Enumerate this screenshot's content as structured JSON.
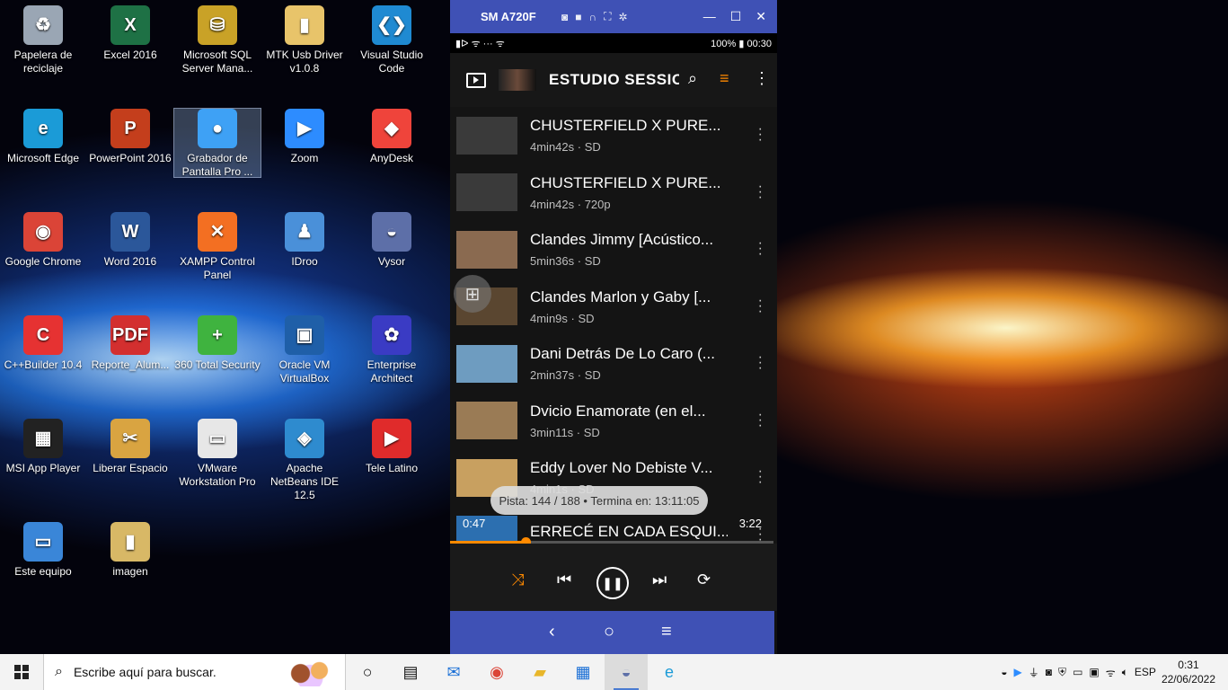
{
  "desktop": {
    "icons": [
      {
        "label": "Papelera de reciclaje",
        "glyph": "♻",
        "color": "#9aa6b4"
      },
      {
        "label": "Excel 2016",
        "glyph": "X",
        "color": "#1e7145"
      },
      {
        "label": "Microsoft SQL Server Mana...",
        "glyph": "⛁",
        "color": "#c9a227"
      },
      {
        "label": "MTK Usb Driver v1.0.8",
        "glyph": "▮",
        "color": "#e8c46a"
      },
      {
        "label": "Visual Studio Code",
        "glyph": "❮❯",
        "color": "#1f8ad2"
      },
      {
        "label": "Microsoft Edge",
        "glyph": "e",
        "color": "#1b9bd7"
      },
      {
        "label": "PowerPoint 2016",
        "glyph": "P",
        "color": "#c43e1c"
      },
      {
        "label": "Grabador de Pantalla Pro ...",
        "glyph": "●",
        "color": "#3ea1f5"
      },
      {
        "label": "Zoom",
        "glyph": "▶",
        "color": "#2d8cff"
      },
      {
        "label": "AnyDesk",
        "glyph": "◆",
        "color": "#ef443b"
      },
      {
        "label": "Google Chrome",
        "glyph": "◉",
        "color": "#db4437"
      },
      {
        "label": "Word 2016",
        "glyph": "W",
        "color": "#2b579a"
      },
      {
        "label": "XAMPP Control Panel",
        "glyph": "✕",
        "color": "#f36f22"
      },
      {
        "label": "IDroo",
        "glyph": "♟",
        "color": "#4a90d9"
      },
      {
        "label": "Vysor",
        "glyph": "◒",
        "color": "#5d6fa8"
      },
      {
        "label": "C++Builder 10.4",
        "glyph": "C",
        "color": "#e63232"
      },
      {
        "label": "Reporte_Alum...",
        "glyph": "PDF",
        "color": "#d32f2f"
      },
      {
        "label": "360 Total Security",
        "glyph": "+",
        "color": "#3fb33f"
      },
      {
        "label": "Oracle VM VirtualBox",
        "glyph": "▣",
        "color": "#1f5fa8"
      },
      {
        "label": "Enterprise Architect",
        "glyph": "✿",
        "color": "#3a3bc4"
      },
      {
        "label": "MSI App Player",
        "glyph": "▦",
        "color": "#222222"
      },
      {
        "label": "Liberar Espacio",
        "glyph": "✂",
        "color": "#d9a441"
      },
      {
        "label": "VMware Workstation Pro",
        "glyph": "▭",
        "color": "#e7e7e7"
      },
      {
        "label": "Apache NetBeans IDE 12.5",
        "glyph": "◈",
        "color": "#2e8bcf"
      },
      {
        "label": "Tele Latino",
        "glyph": "▶",
        "color": "#e02b2b"
      },
      {
        "label": "Este equipo",
        "glyph": "▭",
        "color": "#3a86d8"
      },
      {
        "label": "imagen",
        "glyph": "▮",
        "color": "#d8b866"
      }
    ]
  },
  "vysor": {
    "window_title": "SM A720F",
    "toolbar_icons": [
      "camera-icon",
      "video-icon",
      "headset-icon",
      "fullscreen-icon",
      "settings-icon"
    ],
    "controls": {
      "minimize": "—",
      "maximize": "☐",
      "close": "✕"
    },
    "status_left": "▮ᐅ ᯤ ··· ᯤ",
    "status_right": "100% ▮ 00:30",
    "app_title": "ESTUDIO SESSIONS",
    "playlist": [
      {
        "title": "CHUSTERFIELD X PURE...",
        "meta": "4min42s · SD",
        "thumb": "#3a3a3a"
      },
      {
        "title": "CHUSTERFIELD X PURE...",
        "meta": "4min42s · 720p",
        "thumb": "#3a3a3a"
      },
      {
        "title": "Clandes Jimmy [Acústico...",
        "meta": "5min36s · SD",
        "thumb": "#8a6a50"
      },
      {
        "title": "Clandes Marlon y Gaby [...",
        "meta": "4min9s · SD",
        "thumb": "#5a4630"
      },
      {
        "title": "Dani Detrás De Lo Caro (...",
        "meta": "2min37s · SD",
        "thumb": "#6e9cc0"
      },
      {
        "title": "Dvicio Enamorate (en el...",
        "meta": "3min11s · SD",
        "thumb": "#9a7b55"
      },
      {
        "title": "Eddy Lover No Debiste V...",
        "meta": "4min1s · SD",
        "thumb": "#c8a060"
      },
      {
        "title": "ERRECÉ EN CADA ESQUI...",
        "meta": "",
        "thumb": "#2c6fb0"
      }
    ],
    "toast": "Pista: 144 / 188  •  Termina en: 13:11:05",
    "elapsed": "0:47",
    "duration": "3:22",
    "progress": 0.232
  },
  "taskbar": {
    "search_placeholder": "Escribe aquí para buscar.",
    "language": "ESP",
    "time": "0:31",
    "date": "22/06/2022"
  },
  "colors": {
    "accent": "#ff8a00",
    "vysor_bar": "#3f51b5"
  }
}
